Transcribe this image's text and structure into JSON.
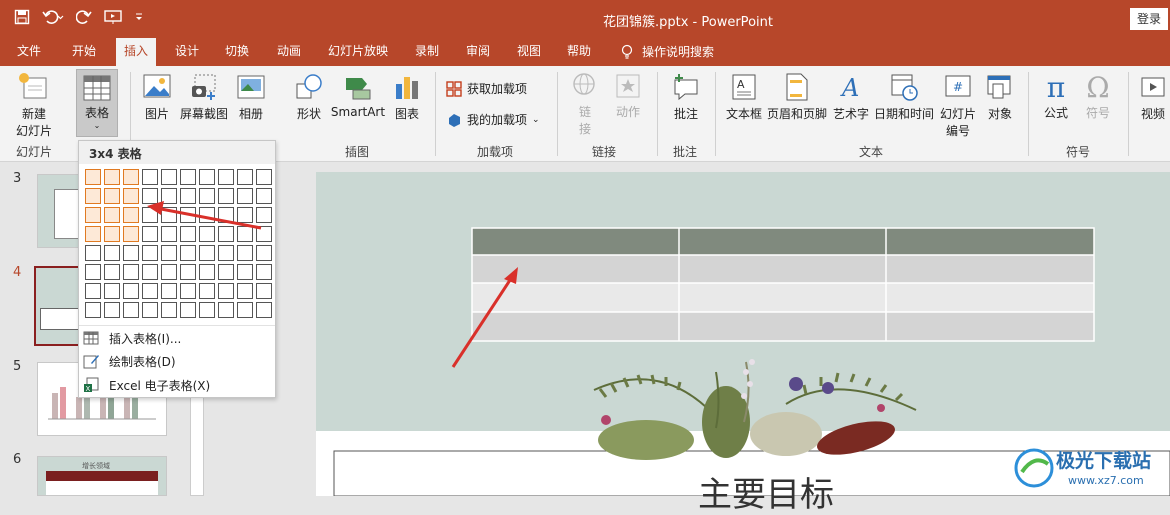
{
  "titlebar": {
    "title": "花团锦簇.pptx  -  PowerPoint",
    "login": "登录"
  },
  "tabs": [
    "文件",
    "开始",
    "插入",
    "设计",
    "切换",
    "动画",
    "幻灯片放映",
    "录制",
    "审阅",
    "视图",
    "帮助"
  ],
  "search_label": "操作说明搜索",
  "ribbon": {
    "new_slide": "新建\n幻灯片",
    "new_slide_1": "新建",
    "new_slide_2": "幻灯片",
    "table": "表格",
    "picture": "图片",
    "screenshot": "屏幕截图",
    "album": "相册",
    "shape": "形状",
    "smartart": "SmartArt",
    "chart": "图表",
    "get_addins": "获取加载项",
    "my_addins": "我的加载项",
    "link": "链接",
    "link_v": [
      "链",
      "接"
    ],
    "action": "动作",
    "comment": "批注",
    "textbox": "文本框",
    "header_footer": "页眉和页脚",
    "wordart": "艺术字",
    "datetime": "日期和时间",
    "slide_number_1": "幻灯片",
    "slide_number_2": "编号",
    "object": "对象",
    "equation": "公式",
    "symbol": "符号",
    "video": "视频",
    "groups": {
      "slides": "幻灯片",
      "illustrations": "插图",
      "addins": "加载项",
      "links": "链接",
      "comments": "批注",
      "text": "文本",
      "symbols": "符号"
    }
  },
  "dropdown": {
    "header": "3x4 表格",
    "grid_cols": 10,
    "grid_rows": 8,
    "highlight_cols": 3,
    "highlight_rows": 4,
    "items": [
      "插入表格(I)...",
      "绘制表格(D)",
      "Excel 电子表格(X)"
    ]
  },
  "slides": {
    "numbers": [
      "3",
      "4",
      "5",
      "6"
    ],
    "slide6_title": "增长领域"
  },
  "slide_title_partial": "主要目标",
  "watermark": {
    "name": "极光下载站",
    "url": "www.xz7.com"
  },
  "colors": {
    "accent": "#b7472a",
    "table_header": "#808a7e",
    "highlight": "#e07a22",
    "arrow": "#d9302a"
  }
}
